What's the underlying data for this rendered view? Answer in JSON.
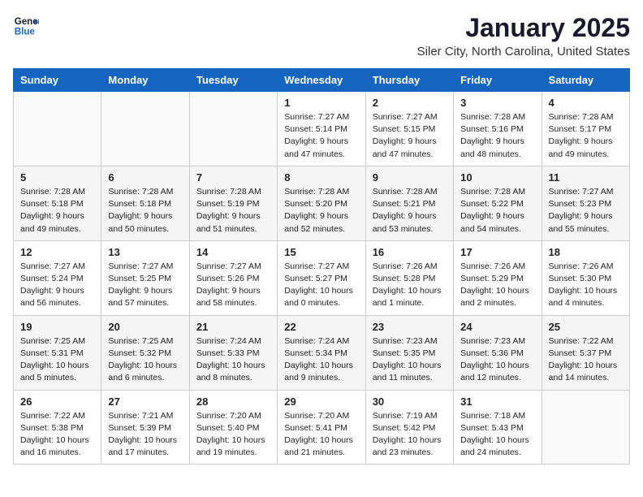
{
  "header": {
    "logo": {
      "line1": "General",
      "line2": "Blue"
    },
    "title": "January 2025",
    "subtitle": "Siler City, North Carolina, United States"
  },
  "weekdays": [
    "Sunday",
    "Monday",
    "Tuesday",
    "Wednesday",
    "Thursday",
    "Friday",
    "Saturday"
  ],
  "weeks": [
    [
      {
        "day": "",
        "info": ""
      },
      {
        "day": "",
        "info": ""
      },
      {
        "day": "",
        "info": ""
      },
      {
        "day": "1",
        "info": "Sunrise: 7:27 AM\nSunset: 5:14 PM\nDaylight: 9 hours\nand 47 minutes."
      },
      {
        "day": "2",
        "info": "Sunrise: 7:27 AM\nSunset: 5:15 PM\nDaylight: 9 hours\nand 47 minutes."
      },
      {
        "day": "3",
        "info": "Sunrise: 7:28 AM\nSunset: 5:16 PM\nDaylight: 9 hours\nand 48 minutes."
      },
      {
        "day": "4",
        "info": "Sunrise: 7:28 AM\nSunset: 5:17 PM\nDaylight: 9 hours\nand 49 minutes."
      }
    ],
    [
      {
        "day": "5",
        "info": "Sunrise: 7:28 AM\nSunset: 5:18 PM\nDaylight: 9 hours\nand 49 minutes."
      },
      {
        "day": "6",
        "info": "Sunrise: 7:28 AM\nSunset: 5:18 PM\nDaylight: 9 hours\nand 50 minutes."
      },
      {
        "day": "7",
        "info": "Sunrise: 7:28 AM\nSunset: 5:19 PM\nDaylight: 9 hours\nand 51 minutes."
      },
      {
        "day": "8",
        "info": "Sunrise: 7:28 AM\nSunset: 5:20 PM\nDaylight: 9 hours\nand 52 minutes."
      },
      {
        "day": "9",
        "info": "Sunrise: 7:28 AM\nSunset: 5:21 PM\nDaylight: 9 hours\nand 53 minutes."
      },
      {
        "day": "10",
        "info": "Sunrise: 7:28 AM\nSunset: 5:22 PM\nDaylight: 9 hours\nand 54 minutes."
      },
      {
        "day": "11",
        "info": "Sunrise: 7:27 AM\nSunset: 5:23 PM\nDaylight: 9 hours\nand 55 minutes."
      }
    ],
    [
      {
        "day": "12",
        "info": "Sunrise: 7:27 AM\nSunset: 5:24 PM\nDaylight: 9 hours\nand 56 minutes."
      },
      {
        "day": "13",
        "info": "Sunrise: 7:27 AM\nSunset: 5:25 PM\nDaylight: 9 hours\nand 57 minutes."
      },
      {
        "day": "14",
        "info": "Sunrise: 7:27 AM\nSunset: 5:26 PM\nDaylight: 9 hours\nand 58 minutes."
      },
      {
        "day": "15",
        "info": "Sunrise: 7:27 AM\nSunset: 5:27 PM\nDaylight: 10 hours\nand 0 minutes."
      },
      {
        "day": "16",
        "info": "Sunrise: 7:26 AM\nSunset: 5:28 PM\nDaylight: 10 hours\nand 1 minute."
      },
      {
        "day": "17",
        "info": "Sunrise: 7:26 AM\nSunset: 5:29 PM\nDaylight: 10 hours\nand 2 minutes."
      },
      {
        "day": "18",
        "info": "Sunrise: 7:26 AM\nSunset: 5:30 PM\nDaylight: 10 hours\nand 4 minutes."
      }
    ],
    [
      {
        "day": "19",
        "info": "Sunrise: 7:25 AM\nSunset: 5:31 PM\nDaylight: 10 hours\nand 5 minutes."
      },
      {
        "day": "20",
        "info": "Sunrise: 7:25 AM\nSunset: 5:32 PM\nDaylight: 10 hours\nand 6 minutes."
      },
      {
        "day": "21",
        "info": "Sunrise: 7:24 AM\nSunset: 5:33 PM\nDaylight: 10 hours\nand 8 minutes."
      },
      {
        "day": "22",
        "info": "Sunrise: 7:24 AM\nSunset: 5:34 PM\nDaylight: 10 hours\nand 9 minutes."
      },
      {
        "day": "23",
        "info": "Sunrise: 7:23 AM\nSunset: 5:35 PM\nDaylight: 10 hours\nand 11 minutes."
      },
      {
        "day": "24",
        "info": "Sunrise: 7:23 AM\nSunset: 5:36 PM\nDaylight: 10 hours\nand 12 minutes."
      },
      {
        "day": "25",
        "info": "Sunrise: 7:22 AM\nSunset: 5:37 PM\nDaylight: 10 hours\nand 14 minutes."
      }
    ],
    [
      {
        "day": "26",
        "info": "Sunrise: 7:22 AM\nSunset: 5:38 PM\nDaylight: 10 hours\nand 16 minutes."
      },
      {
        "day": "27",
        "info": "Sunrise: 7:21 AM\nSunset: 5:39 PM\nDaylight: 10 hours\nand 17 minutes."
      },
      {
        "day": "28",
        "info": "Sunrise: 7:20 AM\nSunset: 5:40 PM\nDaylight: 10 hours\nand 19 minutes."
      },
      {
        "day": "29",
        "info": "Sunrise: 7:20 AM\nSunset: 5:41 PM\nDaylight: 10 hours\nand 21 minutes."
      },
      {
        "day": "30",
        "info": "Sunrise: 7:19 AM\nSunset: 5:42 PM\nDaylight: 10 hours\nand 23 minutes."
      },
      {
        "day": "31",
        "info": "Sunrise: 7:18 AM\nSunset: 5:43 PM\nDaylight: 10 hours\nand 24 minutes."
      },
      {
        "day": "",
        "info": ""
      }
    ]
  ]
}
